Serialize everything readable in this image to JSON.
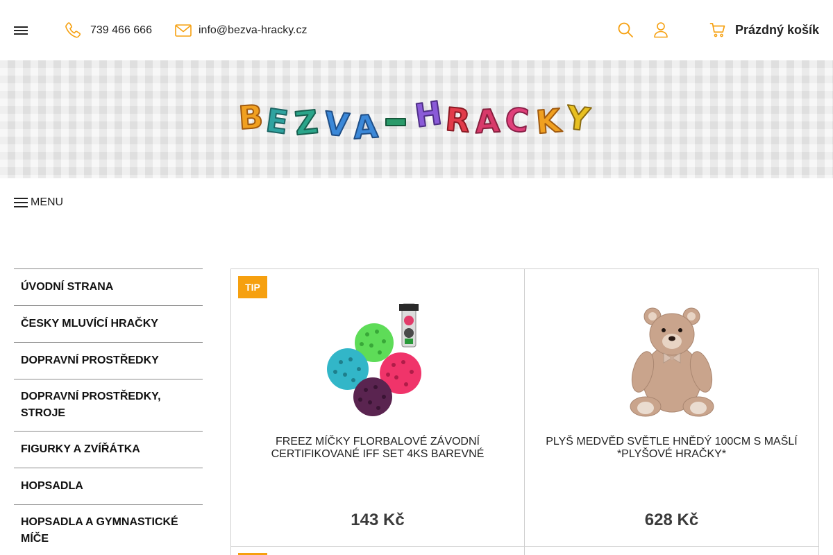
{
  "header": {
    "phone": "739 466 666",
    "email": "info@bezva-hracky.cz",
    "cart_label": "Prázdný košík",
    "accent_color": "#f6a00f"
  },
  "banner": {
    "logo_text": "BEZVA-HRACKY"
  },
  "menu": {
    "label": "MENU"
  },
  "sidebar": {
    "items": [
      {
        "label": "Úvodní strana"
      },
      {
        "label": "Česky mluvící hračky"
      },
      {
        "label": "Dopravní prostředky"
      },
      {
        "label": "Dopravní prostředky, stroje"
      },
      {
        "label": "Figurky a zvířátka"
      },
      {
        "label": "Hopsadla"
      },
      {
        "label": "Hopsadla a gymnastické míče"
      }
    ]
  },
  "products": [
    {
      "badge": "TIP",
      "name": "FREEZ MÍČKY FLORBALOVÉ ZÁVODNÍ CERTIFIKOVANÉ IFF SET 4KS BAREVNÉ",
      "price": "143 Kč",
      "image_icon": "floorball-balls-image"
    },
    {
      "badge": "",
      "name": "PLYŠ MEDVĚD SVĚTLE HNĚDÝ 100CM S MAŠLÍ *PLYŠOVÉ HRAČKY*",
      "price": "628 Kč",
      "image_icon": "teddy-bear-image"
    }
  ]
}
